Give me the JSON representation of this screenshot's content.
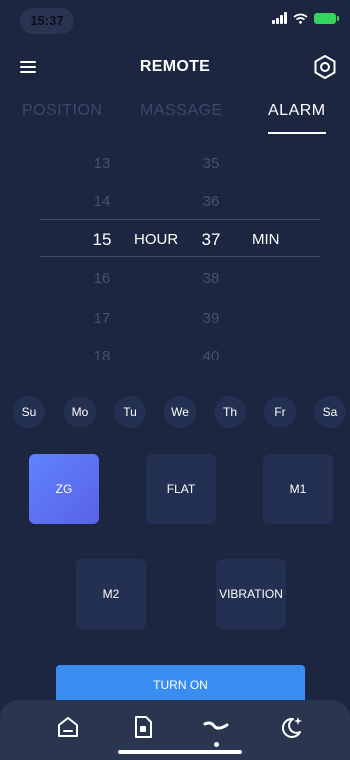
{
  "status_bar": {
    "time": "15:37"
  },
  "header": {
    "title": "REMOTE"
  },
  "tabs": [
    {
      "label": "POSITION",
      "active": false
    },
    {
      "label": "MASSAGE",
      "active": false
    },
    {
      "label": "ALARM",
      "active": true
    }
  ],
  "alarm_picker": {
    "hours": [
      "13",
      "14",
      "15",
      "16",
      "17",
      "18"
    ],
    "minutes": [
      "35",
      "36",
      "37",
      "38",
      "39",
      "40"
    ],
    "selected_hour": "15",
    "selected_minute": "37",
    "hour_unit": "HOUR",
    "minute_unit": "MIN"
  },
  "days": [
    "Su",
    "Mo",
    "Tu",
    "We",
    "Th",
    "Fr",
    "Sa"
  ],
  "modes": [
    {
      "label": "ZG",
      "active": true
    },
    {
      "label": "FLAT",
      "active": false
    },
    {
      "label": "M1",
      "active": false
    },
    {
      "label": "M2",
      "active": false
    },
    {
      "label": "VIBRATION",
      "active": false
    }
  ],
  "turn_on_label": "TURN ON",
  "bottom_nav": {
    "items": [
      {
        "icon": "home-icon"
      },
      {
        "icon": "document-icon"
      },
      {
        "icon": "bed-position-icon",
        "active": true
      },
      {
        "icon": "moon-sparkle-icon"
      }
    ]
  },
  "colors": {
    "background": "#1c2641",
    "tile": "#243051",
    "accent_button": "#3a8df0",
    "active_mode_gradient_start": "#5f83ff",
    "active_mode_gradient_end": "#5a62e6"
  }
}
